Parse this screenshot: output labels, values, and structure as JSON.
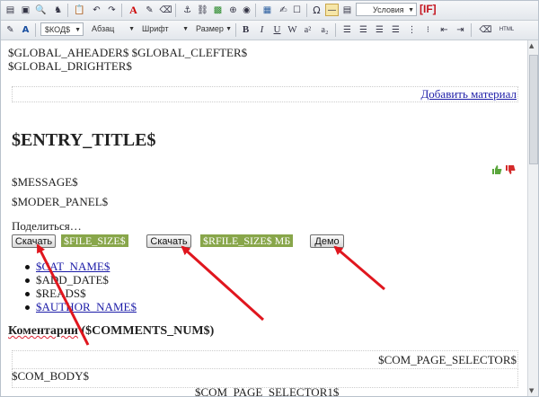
{
  "toolbar": {
    "styles_select": "Условия",
    "if_label": "[IF]",
    "code_select": "$КОД$",
    "paragraph_select": "Абзац",
    "font_select": "Шрифт",
    "size_select": "Размер",
    "bold": "B",
    "italic": "I",
    "underline": "U",
    "strike": "W",
    "superscript": "a²",
    "subscript": "a₂",
    "html_label": "HTML",
    "omega": "Ω",
    "font_color": "A"
  },
  "content": {
    "header_line1": "$GLOBAL_AHEADER$ $GLOBAL_CLEFTER$",
    "header_line2": "$GLOBAL_DRIGHTER$",
    "add_material": "Добавить материал",
    "entry_title": "$ENTRY_TITLE$",
    "message": "$MESSAGE$",
    "moder_panel": "$MODER_PANEL$",
    "share": "Поделиться…",
    "download1": "Скачать",
    "file_size": "$FILE_SIZE$",
    "download2": "Скачать",
    "rfile_size": "$RFILE_SIZE$ МБ",
    "demo": "Демо",
    "list": [
      "$CAT_NAME$",
      "$ADD_DATE$",
      "$READS$",
      "$AUTHOR_NAME$"
    ],
    "comments_word": "Коментарии",
    "comments_count": " ($COMMENTS_NUM$)",
    "com_page_selector": "$COM_PAGE_SELECTOR$",
    "com_body": "$COM_BODY$",
    "com_page_selector1": "$COM_PAGE_SELECTOR1$"
  },
  "colors": {
    "arrow": "#e0161e",
    "tag_bg": "#88a64a",
    "like": "#5aa63c",
    "dislike": "#d42a2a"
  }
}
